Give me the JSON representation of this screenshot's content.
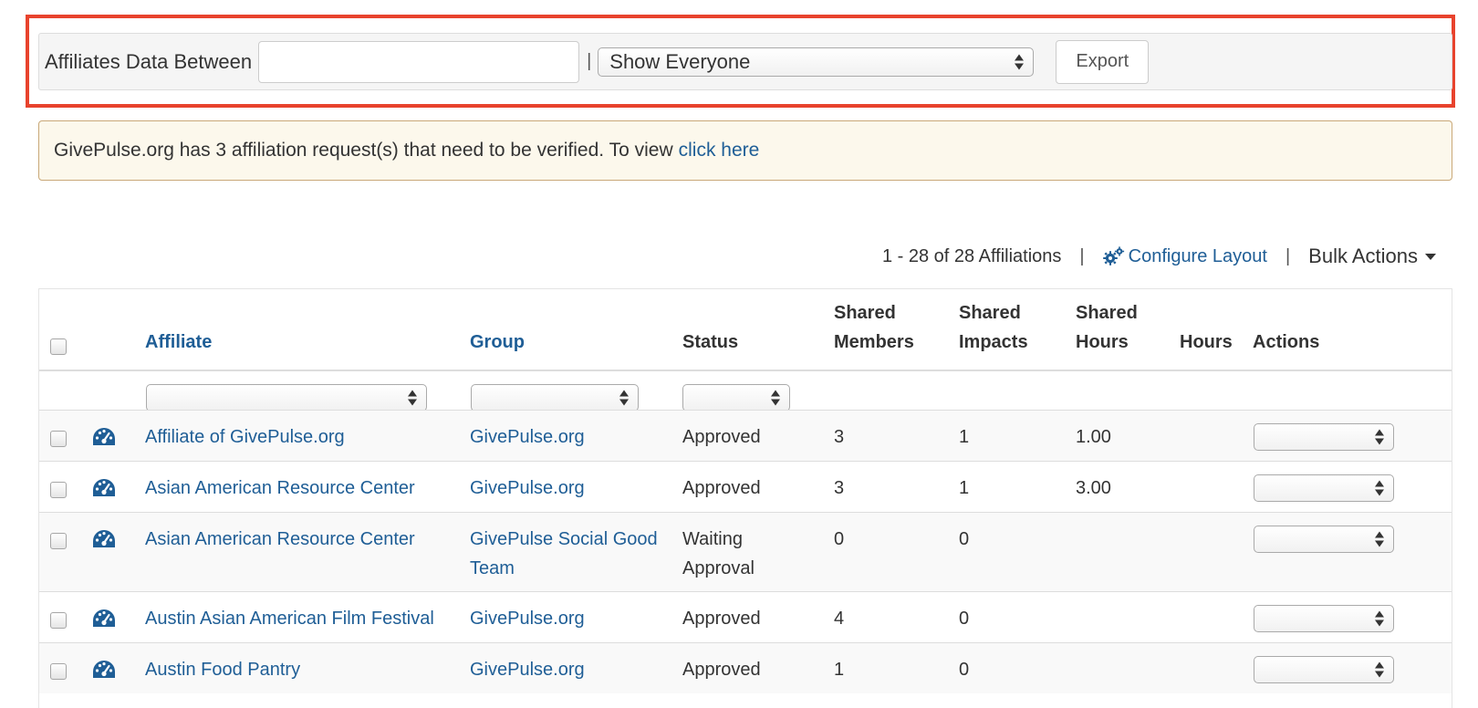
{
  "filter_bar": {
    "label": "Affiliates Data Between",
    "date_value": "",
    "separator": "|",
    "people_select": "Show Everyone",
    "export_label": "Export"
  },
  "alert": {
    "text": "GivePulse.org has 3 affiliation request(s) that need to be verified. To view",
    "link_text": "click here"
  },
  "meta": {
    "count_text": "1 - 28 of 28 Affiliations",
    "separator": "|",
    "configure_label": "Configure Layout",
    "bulk_actions_label": "Bulk Actions"
  },
  "table": {
    "headers": {
      "affiliate": "Affiliate",
      "group": "Group",
      "status": "Status",
      "shared_members_1": "Shared",
      "shared_members_2": "Members",
      "shared_impacts_1": "Shared",
      "shared_impacts_2": "Impacts",
      "shared_hours_1": "Shared",
      "shared_hours_2": "Hours",
      "hours": "Hours",
      "actions": "Actions"
    },
    "rows": [
      {
        "affiliate": "Affiliate of GivePulse.org",
        "group_1": "GivePulse.org",
        "group_2": "",
        "status_1": "Approved",
        "status_2": "",
        "shared_members": "3",
        "shared_impacts": "1",
        "shared_hours": "1.00",
        "hours": ""
      },
      {
        "affiliate": "Asian American Resource Center",
        "group_1": "GivePulse.org",
        "group_2": "",
        "status_1": "Approved",
        "status_2": "",
        "shared_members": "3",
        "shared_impacts": "1",
        "shared_hours": "3.00",
        "hours": ""
      },
      {
        "affiliate": "Asian American Resource Center",
        "group_1": "GivePulse Social Good",
        "group_2": "Team",
        "status_1": "Waiting",
        "status_2": "Approval",
        "shared_members": "0",
        "shared_impacts": "0",
        "shared_hours": "",
        "hours": ""
      },
      {
        "affiliate": "Austin Asian American Film Festival",
        "group_1": "GivePulse.org",
        "group_2": "",
        "status_1": "Approved",
        "status_2": "",
        "shared_members": "4",
        "shared_impacts": "0",
        "shared_hours": "",
        "hours": ""
      },
      {
        "affiliate": "Austin Food Pantry",
        "group_1": "GivePulse.org",
        "group_2": "",
        "status_1": "Approved",
        "status_2": "",
        "shared_members": "1",
        "shared_impacts": "0",
        "shared_hours": "",
        "hours": ""
      }
    ]
  },
  "colors": {
    "highlight": "#e8432d",
    "link": "#1f5e96",
    "alert_bg": "#fcf8ec",
    "alert_border": "#c9a878"
  },
  "icons": {
    "configure": "gears-icon",
    "row": "dashboard-icon",
    "bulk_caret": "caret-down-icon"
  }
}
